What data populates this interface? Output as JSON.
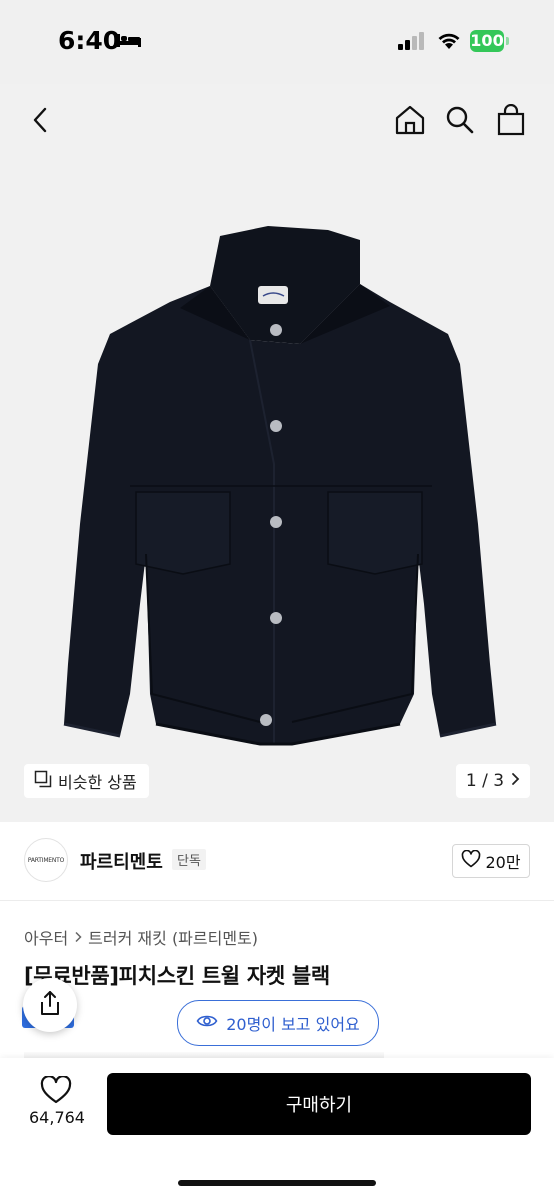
{
  "status": {
    "time": "6:40",
    "battery": "100"
  },
  "header": {
    "back_icon": "chevron-left-icon",
    "home_icon": "home-icon",
    "search_icon": "search-icon",
    "bag_icon": "shopping-bag-icon"
  },
  "gallery": {
    "similar_label": "비슷한 상품",
    "page": "1 / 3"
  },
  "brand": {
    "logo_text": "PARTIMENTO",
    "name": "파르티멘토",
    "badge": "단독",
    "likes": "20만"
  },
  "breadcrumb": {
    "category": "아우터",
    "subcategory": "트러커 재킷 (파르티멘토)"
  },
  "product": {
    "title": "[무료반품]피치스킨 트윌 자켓 블랙",
    "viewers": "20명이 보고 있어요"
  },
  "bottom": {
    "wish_count": "64,764",
    "buy_label": "구매하기"
  },
  "colors": {
    "accent_blue": "#2f6ee0",
    "buy_button": "#000000",
    "battery": "#34c759"
  }
}
